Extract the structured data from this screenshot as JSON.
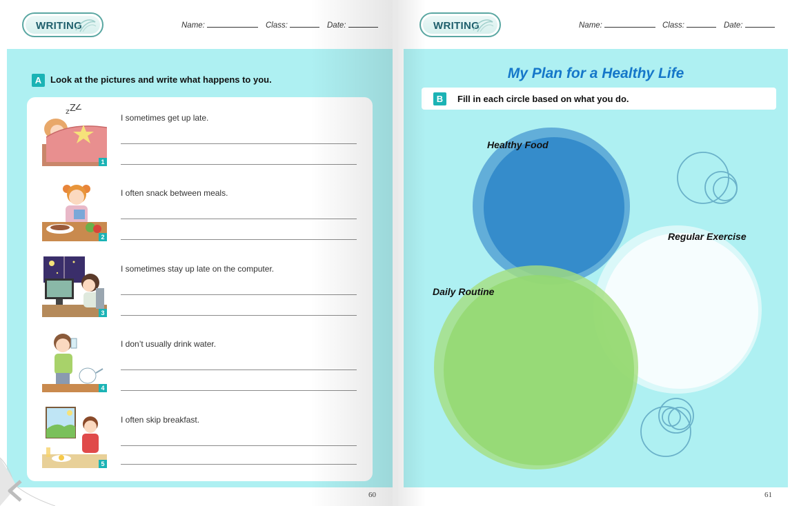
{
  "header": {
    "badge_label": "WRITING",
    "name_label": "Name:",
    "class_label": "Class:",
    "date_label": "Date:"
  },
  "left_page": {
    "section_letter": "A",
    "instruction": "Look at the pictures and write what happens to you.",
    "items": [
      {
        "number": "1",
        "sentence": "I sometimes get up late.",
        "picture": "sleeping-girl-icon"
      },
      {
        "number": "2",
        "sentence": "I often snack between meals.",
        "picture": "snacking-girl-icon"
      },
      {
        "number": "3",
        "sentence": "I sometimes stay up late on the computer.",
        "picture": "computer-boy-icon"
      },
      {
        "number": "4",
        "sentence": "I don’t usually drink water.",
        "picture": "drinking-boy-icon"
      },
      {
        "number": "5",
        "sentence": "I often skip breakfast.",
        "picture": "breakfast-boy-icon"
      }
    ],
    "page_number": "60"
  },
  "right_page": {
    "title": "My Plan for a Healthy Life",
    "section_letter": "B",
    "instruction": "Fill in each circle based on what you do.",
    "circles": [
      {
        "label": "Healthy Food",
        "color": "#2e86c8"
      },
      {
        "label": "Regular Exercise",
        "color": "#ffffff"
      },
      {
        "label": "Daily Routine",
        "color": "#93d86f"
      }
    ],
    "page_number": "61"
  },
  "colors": {
    "panel": "#aef0f2",
    "accent": "#1bb3b5",
    "title": "#1577c9"
  }
}
